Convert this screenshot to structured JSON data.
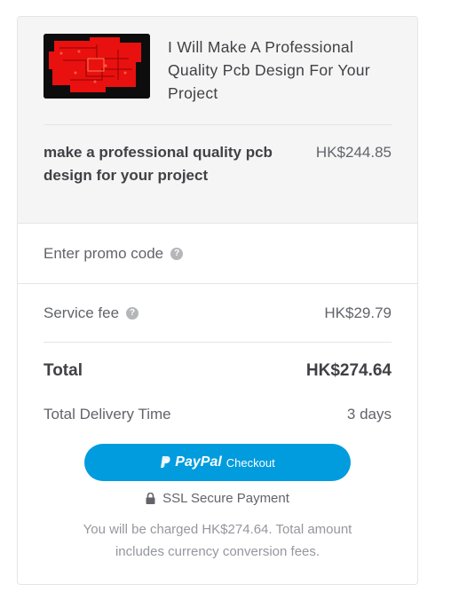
{
  "gig": {
    "title": "I Will Make A Professional Quality Pcb Design For Your Project",
    "thumbnail_alt": "pcb-design-thumbnail"
  },
  "package": {
    "name": "make a professional quality pcb design for your project",
    "price": "HK$244.85"
  },
  "promo": {
    "label": "Enter promo code",
    "help_icon": "question-circle-icon"
  },
  "service_fee": {
    "label": "Service fee",
    "amount": "HK$29.79",
    "help_icon": "question-circle-icon"
  },
  "total": {
    "label": "Total",
    "amount": "HK$274.64"
  },
  "delivery": {
    "label": "Total Delivery Time",
    "value": "3 days"
  },
  "paypal": {
    "brand": "PayPal",
    "action": "Checkout",
    "color": "#009cde"
  },
  "ssl": {
    "label": "SSL Secure Payment",
    "icon": "lock-icon"
  },
  "note": "You will be charged HK$274.64. Total amount includes currency conversion fees."
}
